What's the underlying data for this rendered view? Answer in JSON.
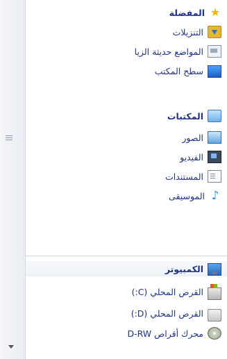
{
  "favorites": {
    "header": "المفضلة",
    "items": [
      {
        "label": "التنزيلات",
        "icon": "downloads-folder-icon"
      },
      {
        "label": "المواضع حديثة الزيا",
        "icon": "recent-places-icon"
      },
      {
        "label": "سطح المكتب",
        "icon": "desktop-icon"
      }
    ]
  },
  "libraries": {
    "header": "المكتبات",
    "items": [
      {
        "label": "الصور",
        "icon": "pictures-icon"
      },
      {
        "label": "الفيديو",
        "icon": "videos-icon"
      },
      {
        "label": "المستندات",
        "icon": "documents-icon"
      },
      {
        "label": "الموسيقى",
        "icon": "music-icon"
      }
    ]
  },
  "computer": {
    "header": "الكمبيوتر",
    "items": [
      {
        "label": "القرص المحلي (C:)",
        "icon": "local-disk-c-icon"
      },
      {
        "label": "القرص المحلي (D:)",
        "icon": "local-disk-d-icon"
      },
      {
        "label": "محرك أقراص D-RW",
        "icon": "dvd-drive-icon"
      }
    ]
  },
  "colors": {
    "link_text": "#1e3287",
    "background": "#ffffff",
    "separator": "#cfd6e0"
  }
}
